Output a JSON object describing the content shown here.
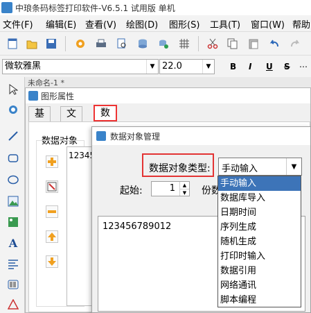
{
  "app": {
    "title": "中琅条码标签打印软件-V6.5.1 试用版 单机"
  },
  "menu": [
    "文件(F)",
    "编辑(E)",
    "查看(V)",
    "绘图(D)",
    "图形(S)",
    "工具(T)",
    "窗口(W)",
    "帮助"
  ],
  "fontbar": {
    "font_name": "微软雅黑",
    "font_size": "22.0",
    "bold": "B",
    "italic": "I",
    "underline": "U",
    "strike": "S"
  },
  "canvas": {
    "doc_tab": "未命名-1 *"
  },
  "props_dialog": {
    "title": "图形属性",
    "tabs": [
      "基本",
      "文字",
      "数据源"
    ],
    "active_tab": "数据源",
    "group_label": "数据对象",
    "list_item": "12345"
  },
  "manager_dialog": {
    "title": "数据对象管理",
    "type_label": "数据对象类型:",
    "type_value": "手动输入",
    "start_label": "起始:",
    "start_value": "1",
    "count_label": "份数",
    "content": "123456789012"
  },
  "dropdown": {
    "options": [
      "手动输入",
      "数据库导入",
      "日期时间",
      "序列生成",
      "随机生成",
      "打印时输入",
      "数据引用",
      "网络通讯",
      "脚本编程"
    ],
    "selected": "手动输入"
  },
  "colors": {
    "highlight": "#e33333",
    "selection": "#3d74b8",
    "accent": "#3a83c9"
  }
}
